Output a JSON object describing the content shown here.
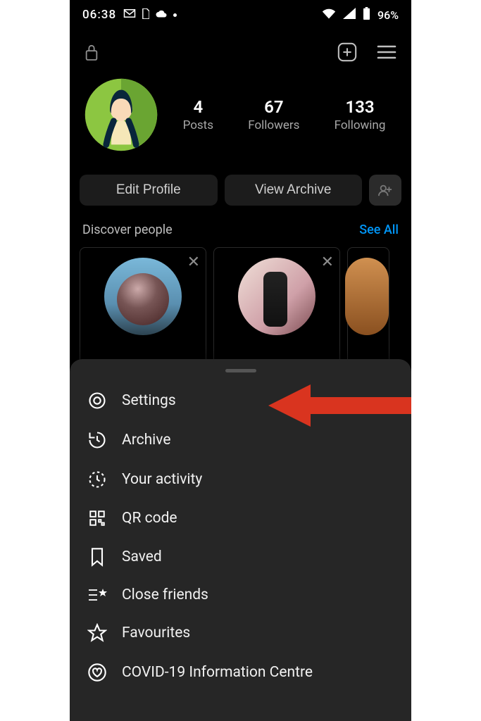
{
  "status": {
    "time": "06:38",
    "battery_pct": "96%"
  },
  "profile": {
    "stats": {
      "posts": {
        "value": "4",
        "label": "Posts"
      },
      "followers": {
        "value": "67",
        "label": "Followers"
      },
      "following": {
        "value": "133",
        "label": "Following"
      }
    }
  },
  "buttons": {
    "edit_profile": "Edit Profile",
    "view_archive": "View Archive"
  },
  "discover": {
    "title": "Discover people",
    "see_all": "See All"
  },
  "menu": {
    "settings": "Settings",
    "archive": "Archive",
    "your_activity": "Your activity",
    "qr_code": "QR code",
    "saved": "Saved",
    "close_friends": "Close friends",
    "favourites": "Favourites",
    "covid": "COVID-19 Information Centre"
  }
}
